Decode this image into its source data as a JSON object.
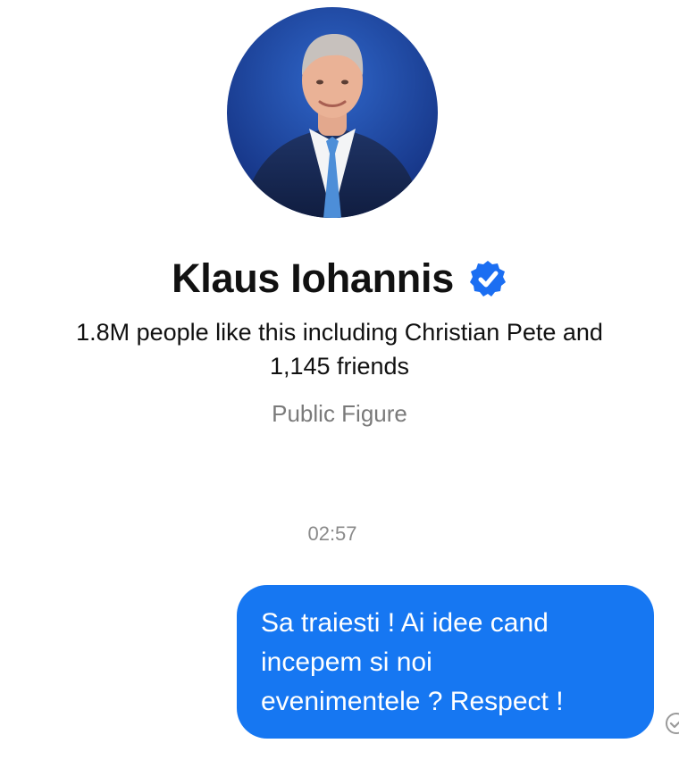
{
  "profile": {
    "name": "Klaus Iohannis",
    "verified_icon": "verified-badge-icon",
    "avatar_icon": "profile-photo",
    "likes_line1": "1.8M people like this including Christian Pete and",
    "likes_line2": "1,145 friends",
    "category": "Public Figure"
  },
  "conversation": {
    "timestamp": "02:57",
    "messages": [
      {
        "direction": "outgoing",
        "lines": [
          "Sa traiesti ! Ai idee cand",
          "incepem si noi",
          "evenimentele ? Respect !"
        ],
        "status_icon": "sent-check-icon"
      }
    ]
  },
  "colors": {
    "bubble_blue": "#1677f2",
    "verified_blue": "#1b6ef2",
    "avatar_background": "#1b3f92"
  }
}
